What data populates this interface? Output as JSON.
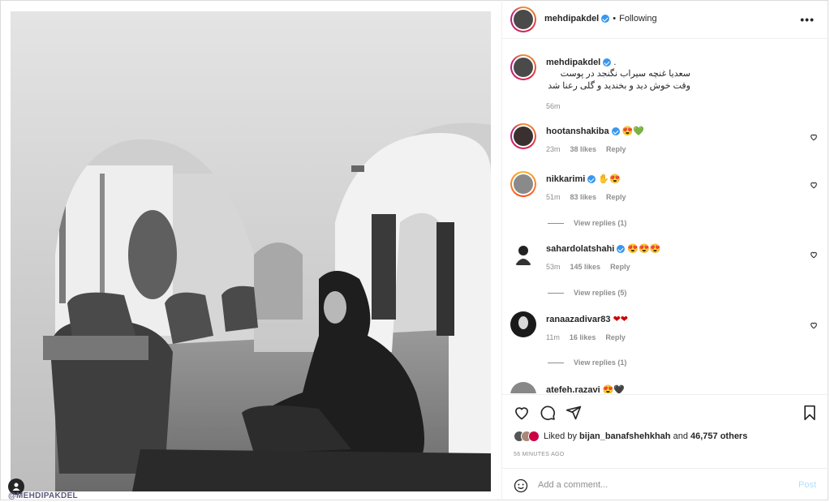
{
  "post": {
    "author": "mehdipakdel",
    "follow_status": "Following",
    "separator": "•",
    "more_label": "•••",
    "watermark": "@MEHDIPAKDEL"
  },
  "caption": {
    "author": "mehdipakdel",
    "suffix": ".",
    "line1": "سعدیا غنچه سیراب نگنجد در پوست",
    "line2": "وقت خوش دید و بخندید و گلی رعنا شد",
    "time": "56m"
  },
  "comments": [
    {
      "user": "hootanshakiba",
      "verified": true,
      "text": "😍💚",
      "time": "23m",
      "likes": "38 likes",
      "reply": "Reply",
      "view_replies": ""
    },
    {
      "user": "nikkarimi",
      "verified": true,
      "text": "✋😍",
      "time": "51m",
      "likes": "83 likes",
      "reply": "Reply",
      "view_replies": "View replies (1)"
    },
    {
      "user": "sahardolatshahi",
      "verified": true,
      "text": "😍😍😍",
      "time": "53m",
      "likes": "145 likes",
      "reply": "Reply",
      "view_replies": "View replies (5)"
    },
    {
      "user": "ranaazadivar83",
      "verified": false,
      "text": "❤❤",
      "time": "11m",
      "likes": "16 likes",
      "reply": "Reply",
      "view_replies": "View replies (1)"
    },
    {
      "user": "atefeh.razavi",
      "verified": false,
      "text": "😍🖤",
      "time": "",
      "likes": "",
      "reply": "",
      "view_replies": ""
    }
  ],
  "likes": {
    "prefix": "Liked by",
    "user": "bijan_banafshehkhah",
    "and": "and",
    "others": "46,757 others"
  },
  "time_ago": "56 MINUTES AGO",
  "comment_box": {
    "placeholder": "Add a comment...",
    "post_label": "Post"
  },
  "colors": {
    "verified": "#3897f0",
    "post_disabled": "#b2dffc",
    "muted": "#8e8e8e"
  }
}
